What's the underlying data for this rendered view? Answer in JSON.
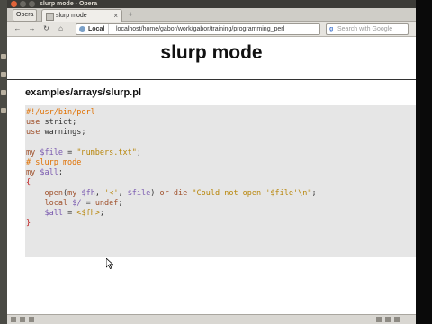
{
  "window": {
    "title": "slurp mode - Opera"
  },
  "tabbar": {
    "opera_button": "Opera",
    "tab_title": "slurp mode",
    "tab_close": "×",
    "new_tab": "+"
  },
  "toolbar": {
    "back": "←",
    "forward": "→",
    "reload": "↻",
    "home": "⌂",
    "address_label": "Local",
    "address_url": "localhost/home/gabor/work/gabor/training/programming_perl",
    "search_placeholder": "Search with Google"
  },
  "page": {
    "title": "slurp mode",
    "file_path": "examples/arrays/slurp.pl"
  },
  "colors": {
    "keyword": "#a0522d",
    "variable": "#7a5ab0",
    "string": "#b8860b",
    "comment": "#e07000",
    "brace": "#c02020"
  }
}
